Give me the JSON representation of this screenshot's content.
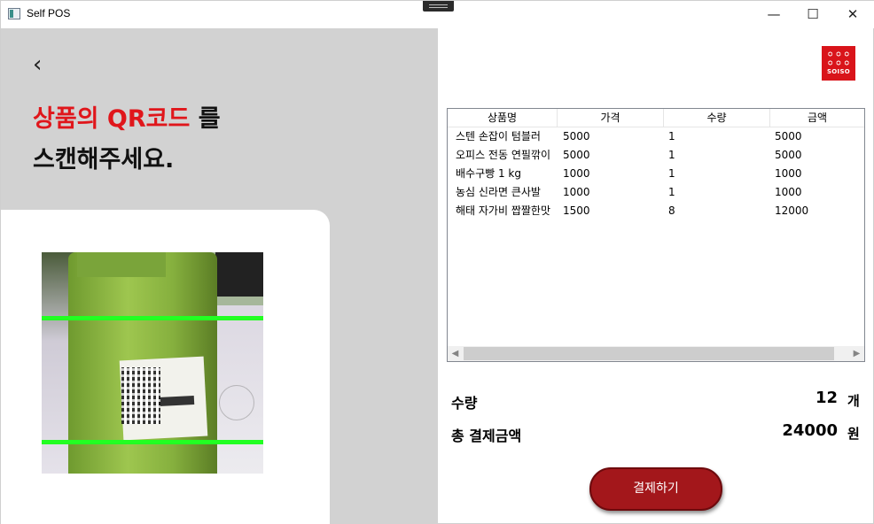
{
  "window": {
    "title": "Self POS",
    "minimize_glyph": "—",
    "maximize_glyph": "☐",
    "close_glyph": "✕"
  },
  "left": {
    "back_glyph": "‹",
    "heading_line1_highlight": "상품의 QR코드",
    "heading_line1_rest": " 를",
    "heading_line2": "스캔해주세요.",
    "highlight_color": "#e0161b",
    "background_color": "#d2d2d2"
  },
  "logo": {
    "text": "SOISO",
    "color": "#d9141a"
  },
  "table": {
    "columns": [
      "상품명",
      "가격",
      "수량",
      "금액"
    ],
    "rows": [
      [
        "스텐 손잡이 텀블러",
        "5000",
        "1",
        "5000"
      ],
      [
        "오피스 전동 연필깎이",
        "5000",
        "1",
        "5000"
      ],
      [
        "배수구빵 1 kg",
        "1000",
        "1",
        "1000"
      ],
      [
        "농심 신라면 큰사발",
        "1000",
        "1",
        "1000"
      ],
      [
        "해태 자가비 짭짤한맛",
        "1500",
        "8",
        "12000"
      ]
    ]
  },
  "summary": {
    "quantity_label": "수량",
    "quantity_value": "12",
    "quantity_unit": "개",
    "total_label": "총 결제금액",
    "total_value": "24000",
    "total_unit": "원"
  },
  "pay_button": {
    "label": "결제하기",
    "color": "#a3171b"
  }
}
